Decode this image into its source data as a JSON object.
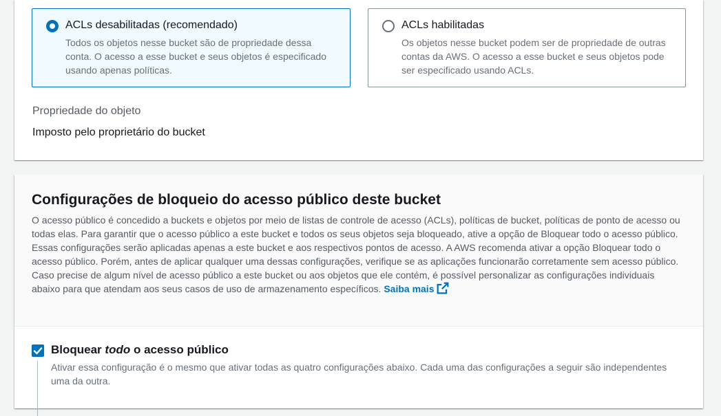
{
  "object_ownership": {
    "options": [
      {
        "title": "ACLs desabilitadas (recomendado)",
        "description": "Todos os objetos nesse bucket são de propriedade dessa conta. O acesso a esse bucket e seus objetos é especificado usando apenas políticas.",
        "selected": true
      },
      {
        "title": "ACLs habilitadas",
        "description": "Os objetos nesse bucket podem ser de propriedade de outras contas da AWS. O acesso a esse bucket e seus objetos pode ser especificado usando ACLs.",
        "selected": false
      }
    ],
    "property_label": "Propriedade do objeto",
    "property_value": "Imposto pelo proprietário do bucket"
  },
  "block_public_access": {
    "title": "Configurações de bloqueio do acesso público deste bucket",
    "description": "O acesso público é concedido a buckets e objetos por meio de listas de controle de acesso (ACLs), políticas de bucket, políticas de ponto de acesso ou todas elas. Para garantir que o acesso público a este bucket e todos os seus objetos seja bloqueado, ative a opção de Bloquear todo o acesso público. Essas configurações serão aplicadas apenas a este bucket e aos respectivos pontos de acesso. A AWS recomenda ativar a opção Bloquear todo o acesso público. Porém, antes de aplicar qualquer uma dessas configurações, verifique se as aplicações funcionarão corretamente sem acesso público. Caso precise de algum nível de acesso público a este bucket ou aos objetos que ele contém, é possível personalizar as configurações individuais abaixo para que atendam aos seus casos de uso de armazenamento específicos.",
    "learn_more": "Saiba mais",
    "block_all": {
      "label_prefix": "Bloquear ",
      "label_emphasis": "todo",
      "label_suffix": " o acesso público",
      "checked": true,
      "description": "Ativar essa configuração é o mesmo que ativar todas as quatro configurações abaixo. Cada uma das configurações a seguir são independentes uma da outra."
    }
  },
  "colors": {
    "accent": "#0073bb",
    "selected_bg": "#f1faff",
    "text": "#16191f",
    "muted": "#687078"
  },
  "icons": {
    "external_link": "external-link-icon",
    "checkmark": "checkmark-icon"
  }
}
